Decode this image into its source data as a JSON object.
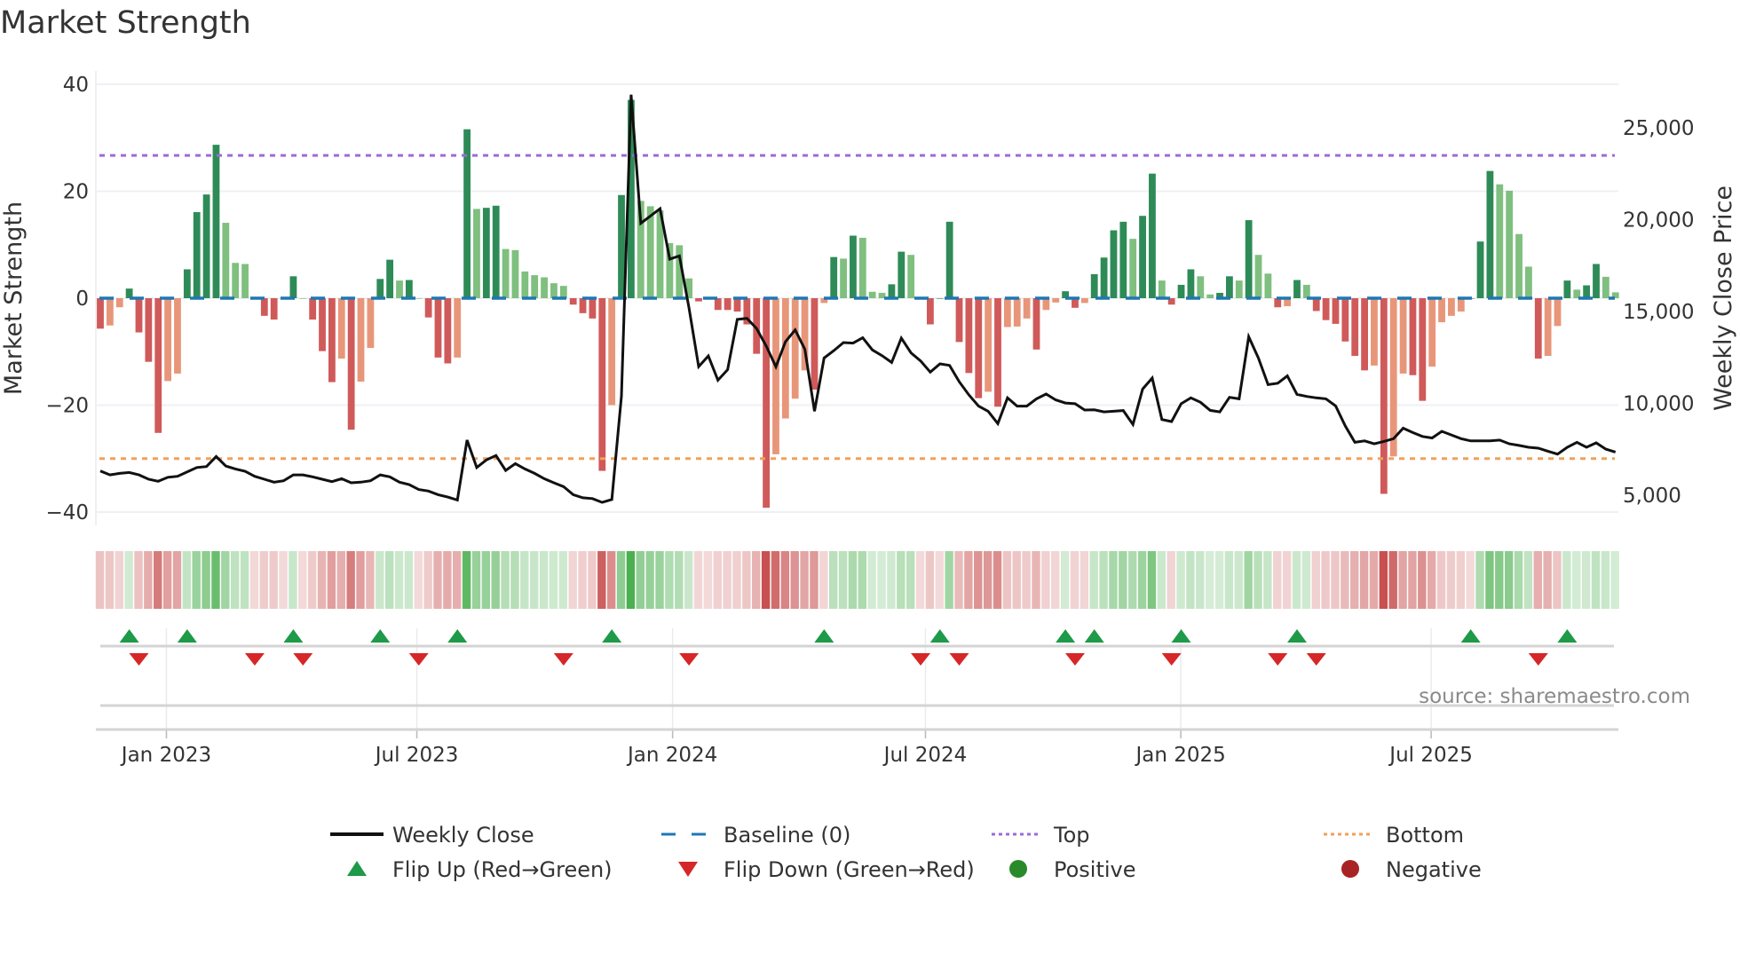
{
  "chart_data": {
    "type": "bar",
    "title": "Market Strength",
    "ylabel": "Market Strength",
    "y2label": "Weekly Close Price",
    "ylim": [
      -42.5,
      42.5
    ],
    "y2lim": [
      3360,
      28090
    ],
    "xlim": [
      0.54,
      158.3
    ],
    "yticks": [
      40,
      20,
      0,
      -20,
      -40
    ],
    "ytick_labels": [
      "40",
      "20",
      "0",
      "−20",
      "−40"
    ],
    "y2ticks": [
      25000,
      20000,
      15000,
      10000,
      5000
    ],
    "y2tick_labels": [
      "25,000",
      "20,000",
      "15,000",
      "10,000",
      "5,000"
    ],
    "xticks": [
      7.85,
      33.8,
      60.3,
      86.5,
      112.96,
      138.9
    ],
    "xtick_labels": [
      "Jan 2023",
      "Jul 2023",
      "Jan 2024",
      "Jul 2024",
      "Jan 2025",
      "Jul 2025"
    ],
    "top_level": 26.7,
    "bottom_level": -30,
    "baseline": 0,
    "grid": true,
    "strength": [
      -5.7,
      -5.1,
      -1.7,
      1.8,
      -6.4,
      -11.9,
      -25.2,
      -15.5,
      -14.1,
      5.4,
      16.1,
      19.4,
      28.7,
      14.1,
      6.6,
      6.4,
      -0.1,
      -3.3,
      -4.0,
      0,
      4.1,
      0,
      -4.0,
      -9.9,
      -15.7,
      -11.3,
      -24.6,
      -15.6,
      -9.3,
      3.6,
      7.2,
      3.3,
      3.4,
      0,
      -3.6,
      -11.1,
      -12.2,
      -11.1,
      31.6,
      16.7,
      16.9,
      17.3,
      9.2,
      9.0,
      5.0,
      4.3,
      3.9,
      2.8,
      2.3,
      -1.2,
      -2.8,
      -3.8,
      -32.3,
      -20.0,
      19.3,
      37.1,
      18.2,
      17.2,
      16.4,
      10.3,
      9.9,
      3.7,
      -0.6,
      0,
      -2.2,
      -2.2,
      -2.5,
      -4.9,
      -10.4,
      -39.2,
      -29.2,
      -22.5,
      -18.8,
      -13.5,
      -17.1,
      -0.9,
      7.7,
      7.4,
      11.7,
      11.3,
      1.2,
      1.0,
      2.6,
      8.7,
      8.1,
      0,
      -4.9,
      0,
      14.3,
      -8.2,
      -14.0,
      -18.7,
      -17.5,
      -20.3,
      -5.4,
      -5.3,
      -3.8,
      -9.6,
      -2.2,
      -0.8,
      1.3,
      -1.8,
      -0.9,
      4.5,
      7.6,
      12.7,
      14.3,
      11.1,
      15.4,
      23.3,
      3.3,
      -1.2,
      2.5,
      5.4,
      4.1,
      0.7,
      1.0,
      4.1,
      3.3,
      14.6,
      8.1,
      4.6,
      -1.7,
      -1.5,
      3.4,
      2.5,
      -2.4,
      -4.1,
      -4.8,
      -8.1,
      -10.8,
      -13.5,
      -12.6,
      -36.6,
      -29.6,
      -14.1,
      -14.4,
      -19.2,
      -12.8,
      -4.5,
      -3.3,
      -2.5,
      0,
      10.6,
      23.8,
      21.3,
      20.1,
      12.0,
      5.9,
      -11.3,
      -10.8,
      -5.2,
      3.3,
      1.6,
      2.4,
      6.4,
      4.0,
      1.1
    ],
    "weekly_close": [
      6320,
      6110,
      6190,
      6240,
      6110,
      5870,
      5760,
      5980,
      6030,
      6270,
      6510,
      6560,
      7110,
      6590,
      6430,
      6300,
      6030,
      5870,
      5710,
      5790,
      6110,
      6110,
      6000,
      5870,
      5740,
      5900,
      5680,
      5710,
      5790,
      6110,
      6000,
      5710,
      5580,
      5310,
      5230,
      5030,
      4900,
      4740,
      8000,
      6510,
      6920,
      7160,
      6350,
      6720,
      6430,
      6190,
      5900,
      5680,
      5470,
      5030,
      4860,
      4820,
      4610,
      4770,
      10380,
      26800,
      19800,
      20200,
      20600,
      17850,
      18030,
      15200,
      12000,
      12580,
      11260,
      11830,
      14570,
      14630,
      14080,
      13120,
      11990,
      13360,
      14000,
      12950,
      9570,
      12470,
      12870,
      13310,
      13280,
      13570,
      12910,
      12600,
      12230,
      13550,
      12750,
      12310,
      11700,
      12150,
      12070,
      11180,
      10460,
      9850,
      9570,
      8900,
      10300,
      9850,
      9850,
      10250,
      10510,
      10190,
      10020,
      9980,
      9640,
      9650,
      9540,
      9570,
      9610,
      8850,
      10780,
      11380,
      9120,
      9010,
      9980,
      10300,
      10060,
      9620,
      9540,
      10330,
      10250,
      13630,
      12470,
      11020,
      11100,
      11500,
      10490,
      10380,
      10300,
      10250,
      9860,
      8770,
      7880,
      7960,
      7800,
      7930,
      8080,
      8650,
      8410,
      8200,
      8120,
      8480,
      8280,
      8080,
      7960,
      7960,
      7960,
      8000,
      7800,
      7710,
      7610,
      7560,
      7400,
      7240,
      7610,
      7880,
      7610,
      7850,
      7510,
      7350
    ],
    "flip_up_weeks": [
      4,
      10,
      21,
      30,
      38,
      54,
      76,
      88,
      101,
      104,
      113,
      125,
      143,
      153
    ],
    "flip_down_weeks": [
      5,
      17,
      22,
      34,
      49,
      62,
      86,
      90,
      102,
      112,
      123,
      127,
      150
    ],
    "legend": [
      {
        "label": "Weekly Close",
        "kind": "line",
        "color": "#111111"
      },
      {
        "label": "Baseline (0)",
        "kind": "dash",
        "color": "#1f77b4"
      },
      {
        "label": "Top",
        "kind": "dot",
        "color": "#9b6bd6"
      },
      {
        "label": "Bottom",
        "kind": "dot",
        "color": "#f0a05a"
      },
      {
        "label": "Flip Up (Red→Green)",
        "kind": "tri-up",
        "color": "#1e9a48"
      },
      {
        "label": "Flip Down (Green→Red)",
        "kind": "tri-down",
        "color": "#d62728"
      },
      {
        "label": "Positive",
        "kind": "circle",
        "color": "#2a8a2a"
      },
      {
        "label": "Negative",
        "kind": "circle",
        "color": "#a82424"
      }
    ],
    "legend_position": "bottom",
    "source": "source: sharemaestro.com",
    "colors": {
      "pos_strong": "#2e8b57",
      "pos_weak": "#7fbf7f",
      "neg_strong": "#d05a5a",
      "neg_weak": "#e8967a",
      "price": "#111111",
      "baseline": "#1f77b4",
      "top": "#9b6bd6",
      "bottom": "#f0a05a",
      "grid": "#eef0f4"
    }
  }
}
